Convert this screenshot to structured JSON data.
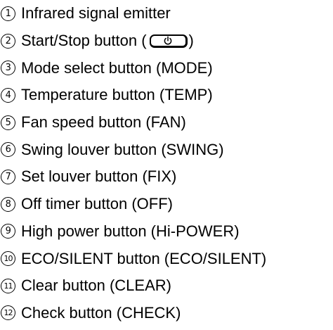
{
  "items": [
    {
      "number": "1",
      "label": "Infrared signal emitter"
    },
    {
      "number": "2",
      "label_before": "Start/Stop button (",
      "label_after": ")",
      "icon": "power-icon"
    },
    {
      "number": "3",
      "label": "Mode select button (MODE)"
    },
    {
      "number": "4",
      "label": "Temperature button (TEMP)"
    },
    {
      "number": "5",
      "label": "Fan speed button (FAN)"
    },
    {
      "number": "6",
      "label": "Swing louver button (SWING)"
    },
    {
      "number": "7",
      "label": "Set louver button (FIX)"
    },
    {
      "number": "8",
      "label": "Off timer button (OFF)"
    },
    {
      "number": "9",
      "label": "High power button (Hi-POWER)"
    },
    {
      "number": "10",
      "label": "ECO/SILENT button (ECO/SILENT)"
    },
    {
      "number": "11",
      "label": "Clear button (CLEAR)"
    },
    {
      "number": "12",
      "label": "Check button (CHECK)"
    }
  ]
}
